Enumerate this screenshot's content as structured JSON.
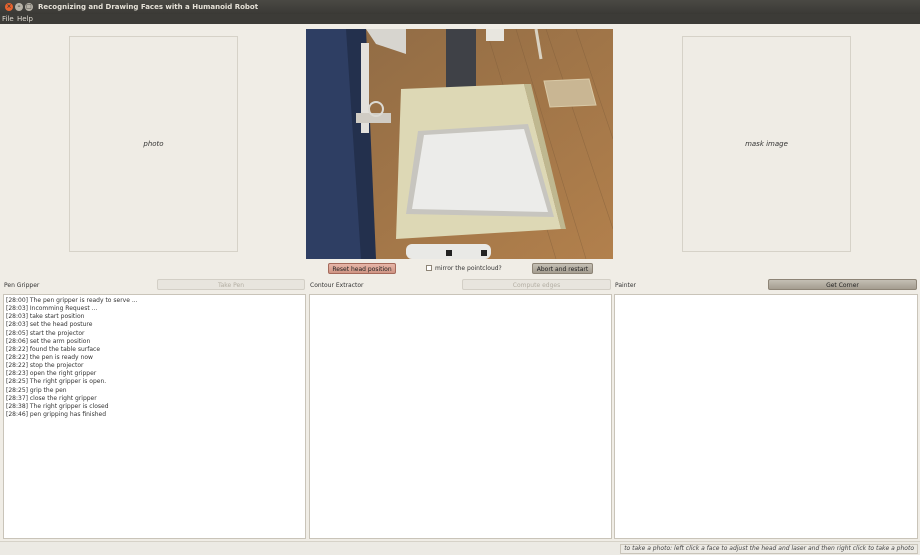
{
  "window": {
    "title": "Recognizing and Drawing Faces with a Humanoid Robot",
    "controls": {
      "close": "×",
      "minimize": "–",
      "maximize": "□"
    }
  },
  "menu": {
    "file": "File",
    "help": "Help"
  },
  "panels": {
    "photo_label": "photo",
    "mask_label": "mask image"
  },
  "controls": {
    "reset_head": "Reset head position",
    "mirror_label": "mirror the pointcloud?",
    "abort_restart": "Abort and restart"
  },
  "sections": {
    "pen_gripper": {
      "label": "Pen Gripper",
      "button": "Take Pen"
    },
    "contour": {
      "label": "Contour Extractor",
      "button": "Compute edges"
    },
    "painter": {
      "label": "Painter",
      "button": "Get Corner"
    }
  },
  "log": [
    "[28:00] The pen gripper is ready to serve ...",
    "[28:03] Incomming Request ...",
    "[28:03] take start position",
    "[28:03] set the head posture",
    "[28:05] start the projector",
    "[28:06] set the arm position",
    "[28:22] found the table surface",
    "[28:22] the pen is ready now",
    "[28:22] stop the projector",
    "[28:23] open the right gripper",
    "[28:25] The right gripper is open.",
    "[28:25] grip the pen",
    "[28:37] close the right gripper",
    "[28:38] The right gripper is closed",
    "[28:46] pen gripping has finished"
  ],
  "status": {
    "message": "to take a photo: left click a face to adjust the head and laser and then right click to take a photo"
  }
}
